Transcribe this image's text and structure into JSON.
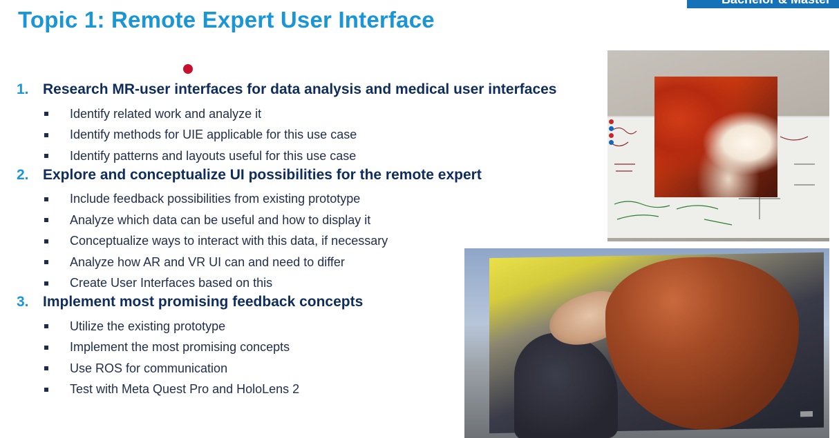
{
  "corner_badge": "Bachelor & Master",
  "slide_title": "Topic 1: Remote Expert User Interface",
  "sections": [
    {
      "number": "1.",
      "heading": "Research MR-user interfaces for data analysis and medical user interfaces",
      "bullets": [
        "Identify related work and analyze it",
        "Identify methods for UIE applicable for this use case",
        "Identify patterns and layouts useful for this use case"
      ]
    },
    {
      "number": "2.",
      "heading": "Explore and conceptualize UI possibilities for the remote expert",
      "bullets": [
        "Include feedback possibilities from existing prototype",
        "Analyze which data can be useful and how to display it",
        "Conceptualize ways to interact with this data, if necessary",
        "Analyze how AR and VR UI can and need to differ",
        "Create User Interfaces based on this"
      ]
    },
    {
      "number": "3.",
      "heading": "Implement most promising feedback concepts",
      "bullets": [
        "Utilize the existing prototype",
        "Implement the most promising concepts",
        "Use ROS for communication",
        "Test with Meta Quest Pro and HoloLens 2"
      ]
    }
  ],
  "colors": {
    "title": "#1a96d6",
    "heading": "#0f2d5c",
    "body": "#1f2d4a",
    "badge": "#1572b8",
    "pointer": "#c8102e"
  },
  "images": {
    "photo_top": "whiteboard-projection-photo",
    "photo_bottom": "liver-scan-photo"
  }
}
